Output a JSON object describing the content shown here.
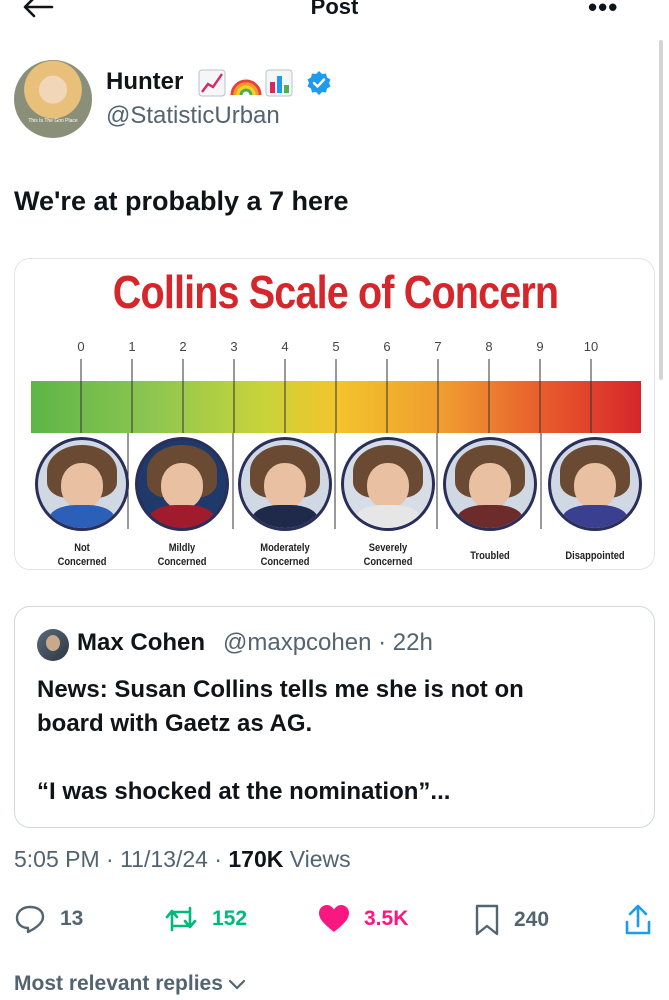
{
  "header": {
    "title": "Post",
    "more_label": "•••"
  },
  "author": {
    "name": "Hunter",
    "name_emojis": [
      "chart-increasing-emoji",
      "rainbow-emoji",
      "bar-chart-emoji"
    ],
    "handle": "@StatisticUrban",
    "verified": true,
    "avatar_caption": "This Is The Goo Place"
  },
  "tweet": {
    "text": "We're at probably a 7 here"
  },
  "media": {
    "title": "Collins Scale of Concern",
    "ticks": [
      "0",
      "1",
      "2",
      "3",
      "4",
      "5",
      "6",
      "7",
      "8",
      "9",
      "10"
    ],
    "levels": [
      {
        "label_line1": "Not",
        "label_line2": "Concerned",
        "shirt": "#2c5fb8"
      },
      {
        "label_line1": "Mildly",
        "label_line2": "Concerned",
        "shirt": "#a01c2c"
      },
      {
        "label_line1": "Moderately",
        "label_line2": "Concerned",
        "shirt": "#1f2a4a"
      },
      {
        "label_line1": "Severely",
        "label_line2": "Concerned",
        "shirt": "#e6e6e6"
      },
      {
        "label_line1": "Troubled",
        "label_line2": "",
        "shirt": "#6d2b2b"
      },
      {
        "label_line1": "Disappointed",
        "label_line2": "",
        "shirt": "#3a3f8f"
      }
    ],
    "gradient_colors": [
      "#5db548",
      "#8dc650",
      "#c7d43a",
      "#f3c52b",
      "#ef9b30",
      "#e85c2c",
      "#d6262a"
    ]
  },
  "quote": {
    "name": "Max Cohen",
    "handle_time": "@maxpcohen · 22h",
    "body_line1": "News: Susan Collins tells me she is not on",
    "body_line2": "board with Gaetz as AG.",
    "body_line3": "“I was shocked at the nomination”..."
  },
  "meta": {
    "time_date": "5:05 PM · 11/13/24 · ",
    "views_count": "170K",
    "views_label": " Views"
  },
  "actions": {
    "replies": "13",
    "reposts": "152",
    "likes": "3.5K",
    "bookmarks": "240"
  },
  "colors": {
    "repost": "#00ba7c",
    "like": "#f91880",
    "verified": "#1d9bf0",
    "secondary_text": "#536471"
  },
  "replies_sort": {
    "label": "Most relevant replies"
  }
}
